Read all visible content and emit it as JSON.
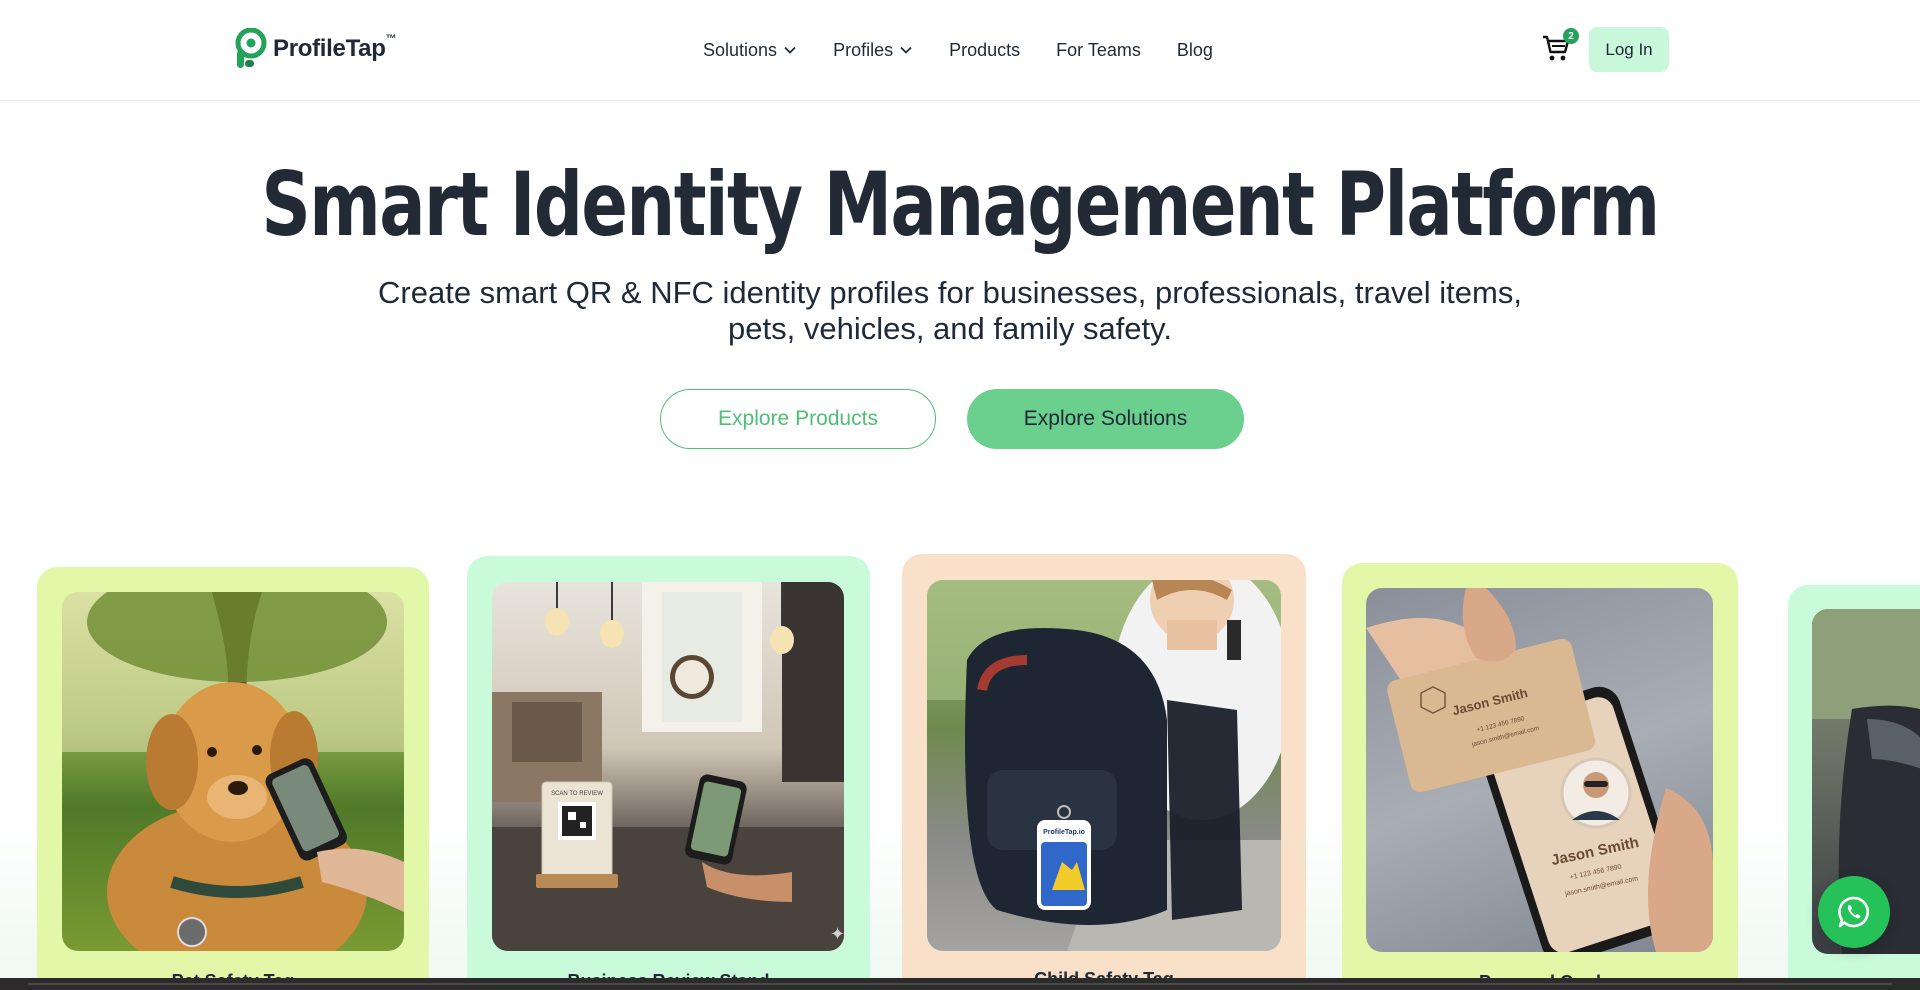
{
  "brand": {
    "name": "ProfileTap",
    "tm": "™",
    "green": "#22a35a"
  },
  "nav": {
    "items": [
      {
        "label": "Solutions",
        "dropdown": true
      },
      {
        "label": "Profiles",
        "dropdown": true
      },
      {
        "label": "Products",
        "dropdown": false
      },
      {
        "label": "For Teams",
        "dropdown": false
      },
      {
        "label": "Blog",
        "dropdown": false
      }
    ],
    "cart_count": "2",
    "login_label": "Log In"
  },
  "hero": {
    "title": "Smart Identity Management Platform",
    "subtitle": "Create smart QR & NFC identity profiles for businesses, professionals, travel items, pets, vehicles, and family safety.",
    "primary_button": "Explore Products",
    "secondary_button": "Explore Solutions"
  },
  "cards": [
    {
      "label": "Pet Safety Tag",
      "bg": "#e3f7a8",
      "image": "golden-retriever-with-qr-tag"
    },
    {
      "label": "Business Review Stand",
      "bg": "#c9fbdb",
      "image": "cafe-qr-review-stand"
    },
    {
      "label": "Child Safety Tag",
      "bg": "#f8e1c8",
      "image": "child-backpack-tag"
    },
    {
      "label": "Personal Card",
      "bg": "#e3f7a8",
      "image": "wooden-nfc-business-card"
    },
    {
      "label": "",
      "bg": "#c9fbdb",
      "image": "vehicle-tag"
    }
  ],
  "card_profile": {
    "name": "Jason Smith",
    "phone": "+1 123 456 7890",
    "email": "jason.smith@email.com"
  },
  "qr_stand": {
    "header": "SCAN TO REVIEW"
  },
  "tag_brand": "ProfileTap.io",
  "whatsapp": {
    "icon": "whatsapp-icon"
  }
}
